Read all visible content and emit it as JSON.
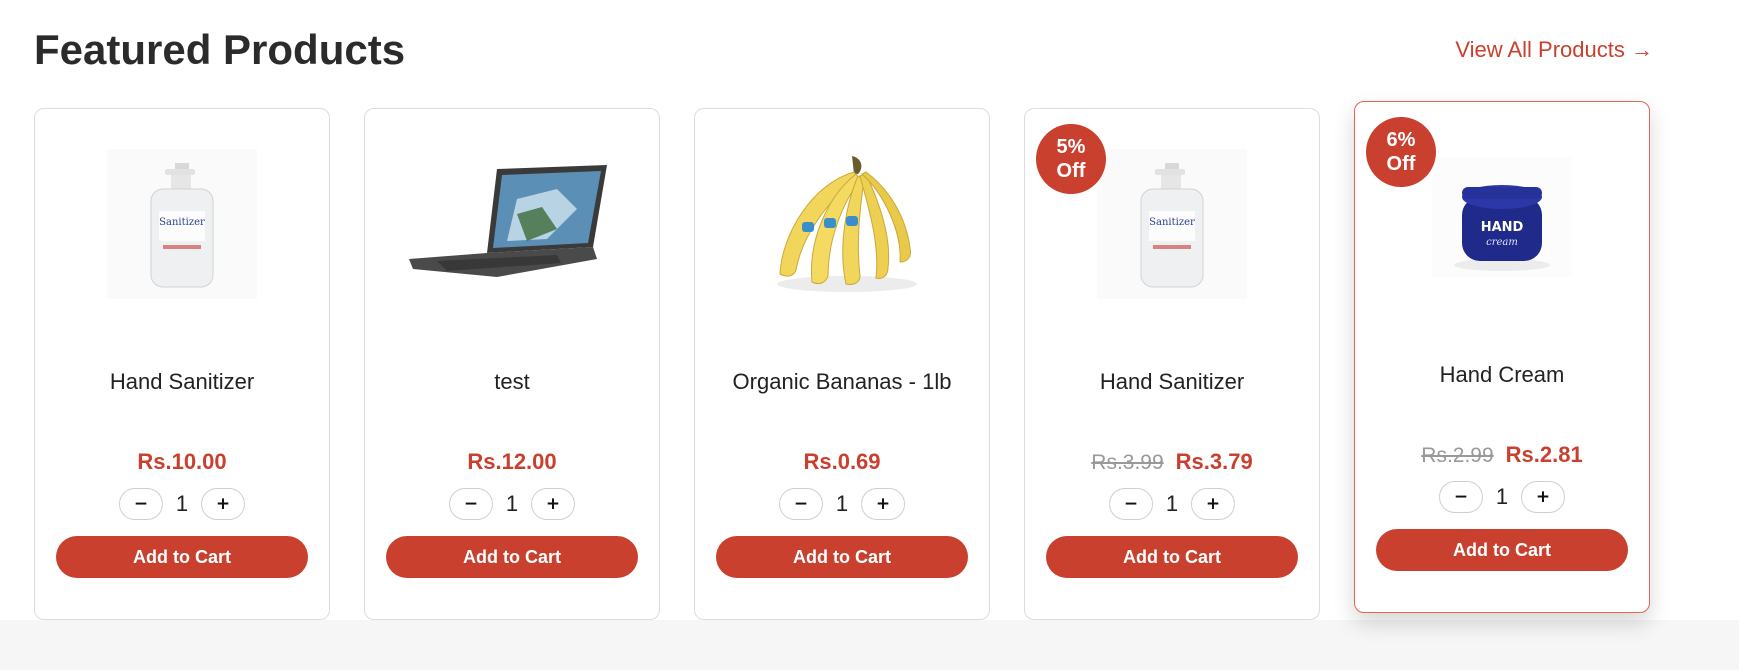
{
  "section": {
    "title": "Featured Products",
    "view_all": "View All Products →"
  },
  "colors": {
    "accent": "#c9402f",
    "text": "#222222",
    "muted": "#999999"
  },
  "products": [
    {
      "name": "Hand Sanitizer",
      "image": "hand-sanitizer-image",
      "price": "Rs.10.00",
      "old_price": "",
      "badge_pct": "",
      "badge_off": "",
      "qty": "1",
      "minus": "−",
      "plus": "+",
      "cta": "Add to Cart"
    },
    {
      "name": "test",
      "image": "laptop-image",
      "price": "Rs.12.00",
      "old_price": "",
      "badge_pct": "",
      "badge_off": "",
      "qty": "1",
      "minus": "−",
      "plus": "+",
      "cta": "Add to Cart"
    },
    {
      "name": "Organic Bananas - 1lb",
      "image": "bananas-image",
      "price": "Rs.0.69",
      "old_price": "",
      "badge_pct": "",
      "badge_off": "",
      "qty": "1",
      "minus": "−",
      "plus": "+",
      "cta": "Add to Cart"
    },
    {
      "name": "Hand Sanitizer",
      "image": "hand-sanitizer-image",
      "price": "Rs.3.79",
      "old_price": "Rs.3.99",
      "badge_pct": "5%",
      "badge_off": "Off",
      "qty": "1",
      "minus": "−",
      "plus": "+",
      "cta": "Add to Cart"
    },
    {
      "name": "Hand Cream",
      "image": "hand-cream-image",
      "price": "Rs.2.81",
      "old_price": "Rs.2.99",
      "badge_pct": "6%",
      "badge_off": "Off",
      "qty": "1",
      "minus": "−",
      "plus": "+",
      "cta": "Add to Cart"
    }
  ]
}
